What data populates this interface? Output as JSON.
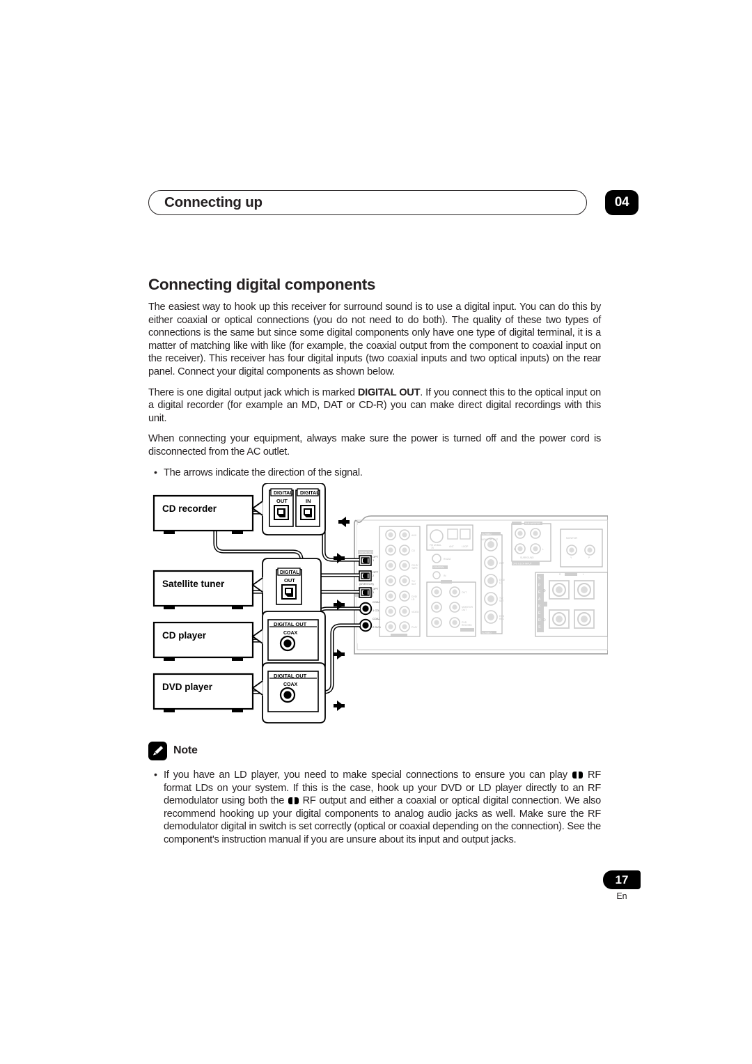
{
  "header": {
    "title": "Connecting up",
    "chapter": "04"
  },
  "main": {
    "section_title": "Connecting digital components",
    "paragraph_1": "The easiest way to hook up this receiver for surround sound is to use a digital input. You can do this by either coaxial or optical connections (you do not need to do both). The quality of these two types of connections is the same but since some digital components only have one type of digital terminal, it is a matter of matching like with like (for example, the coaxial output from the component to coaxial input on the receiver). This receiver has four digital inputs (two coaxial inputs and two optical inputs) on the rear panel. Connect your digital components as shown below.",
    "paragraph_2_a": "There is one digital output jack which is marked ",
    "paragraph_2_bold": "DIGITAL OUT",
    "paragraph_2_b": ". If you connect this to the optical input on a digital recorder (for example an MD, DAT or CD-R) you can make direct digital recordings with this unit.",
    "paragraph_3": "When connecting your equipment, always make sure the power is turned off and the power cord is disconnected from the AC outlet.",
    "bullet_1": "The arrows indicate the direction of the signal."
  },
  "note": {
    "label": "Note",
    "icon": "pencil-icon",
    "bullet_a": "If you have an LD player, you need to make special connections to ensure you can play ",
    "bullet_b": " RF format LDs on your system. If this is the case, hook up your DVD or LD player directly to an RF demodulator using both the ",
    "bullet_c": " RF output and either a coaxial or optical digital connection. We also recommend hooking up your digital components to analog audio jacks as well. Make sure the RF demodulator digital in switch is set correctly (optical or coaxial depending on the connection). See the component's instruction manual if you are unsure about its input and output jacks."
  },
  "footer": {
    "page_number": "17",
    "language": "En"
  },
  "figure": {
    "devices": [
      {
        "name": "CD recorder",
        "jacks": [
          "DIGITAL OUT",
          "DIGITAL IN"
        ]
      },
      {
        "name": "Satellite tuner",
        "jacks": [
          "DIGITAL OUT"
        ]
      },
      {
        "name": "CD player",
        "jacks": [
          "DIGITAL OUT COAX"
        ]
      },
      {
        "name": "DVD player",
        "jacks": [
          "DIGITAL OUT COAX"
        ]
      }
    ],
    "device_cd_recorder": "CD recorder",
    "device_satellite_tuner": "Satellite tuner",
    "device_cd_player": "CD player",
    "device_dvd_player": "DVD player",
    "jack_digital": "DIGITAL",
    "jack_out": "OUT",
    "jack_in": "IN",
    "jack_digital_out": "DIGITAL OUT",
    "jack_coax": "COAX",
    "receiver": {
      "digital_out_label": "DIGITAL OUT",
      "digital_in_label": "DIGITAL IN",
      "opt_1": "OPT",
      "opt_2": "OPT",
      "opt_3": "OPT",
      "coax_1": "COAX",
      "coax_2": "COAX",
      "dvr_vcr": "(DVR/VCR)",
      "speakers": "SPEAKERS",
      "surround": "SURROUND",
      "sub_woofer": "SUB WOOFER",
      "monitor_out": "MONITOR OUT",
      "dvd_6ch_input": "DVD 6.1CH INPUT",
      "s_video": "S-VIDEO",
      "control": "CONTROL",
      "antenna": "FM UNBAL 75"
    }
  }
}
